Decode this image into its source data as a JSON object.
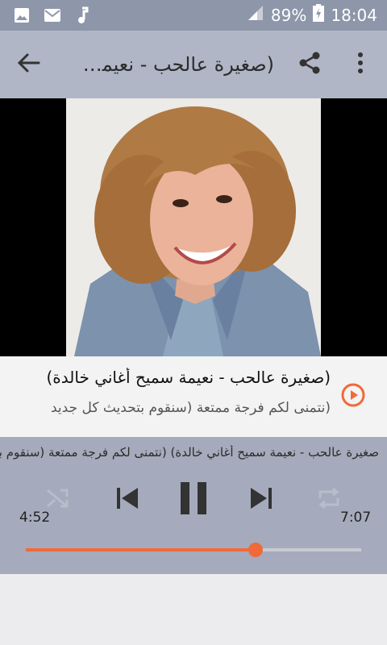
{
  "statusbar": {
    "battery": "89%",
    "time": "18:04",
    "icons": [
      "image-icon",
      "mail-icon",
      "music-note-icon",
      "signal-icon",
      "battery-charging-icon"
    ]
  },
  "appbar": {
    "title": "(صغيرة عالحب - نعيمة سميح أغاني خالدة)",
    "icons": [
      "back-arrow-icon",
      "share-icon",
      "more-vert-icon"
    ]
  },
  "track": {
    "title": "(صغيرة عالحب - نعيمة سميح أغاني خالدة)",
    "subtitle": "(نتمنى لكم فرجة ممتعة (سنقوم بتحديث كل جديد"
  },
  "player": {
    "marquee": "صغيرة عالحب - نعيمة سميح أغاني خالدة) (نتمنى لكم فرجة ممتعة (سنقوم بتحديث كل جديد",
    "elapsed": "4:52",
    "duration": "7:07",
    "progress": 0.685,
    "accent_color": "#f06a39",
    "controls": [
      "shuffle-icon",
      "previous-icon",
      "pause-icon",
      "next-icon",
      "repeat-icon"
    ]
  }
}
